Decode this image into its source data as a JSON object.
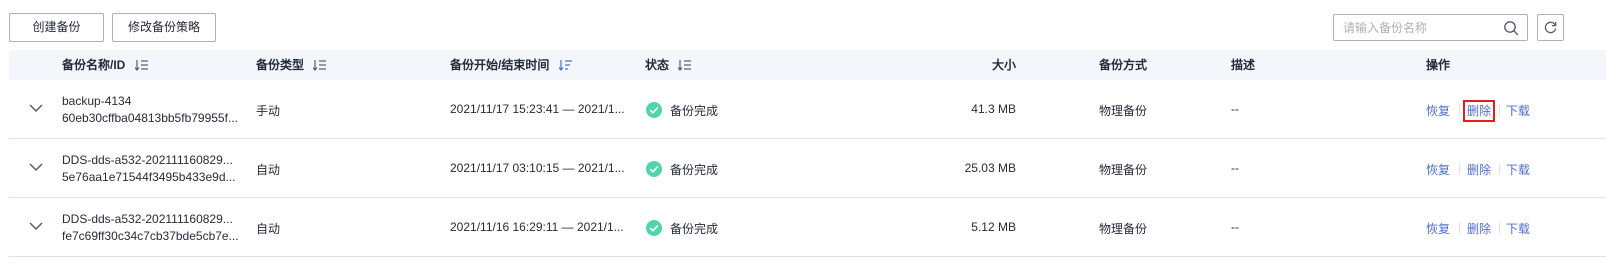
{
  "toolbar": {
    "create_label": "创建备份",
    "policy_label": "修改备份策略",
    "search_placeholder": "请输入备份名称"
  },
  "columns": {
    "name": "备份名称/ID",
    "type": "备份类型",
    "time": "备份开始/结束时间",
    "status": "状态",
    "size": "大小",
    "method": "备份方式",
    "desc": "描述",
    "ops": "操作"
  },
  "rows": [
    {
      "name": "backup-4134",
      "id": "60eb30cffba04813bb5fb79955f...",
      "type": "手动",
      "time": "2021/11/17 15:23:41 — 2021/1...",
      "status": "备份完成",
      "size": "41.3 MB",
      "method": "物理备份",
      "desc": "--",
      "restore": "恢复",
      "delete": "删除",
      "download": "下载"
    },
    {
      "name": "DDS-dds-a532-202111160829...",
      "id": "5e76aa1e71544f3495b433e9d...",
      "type": "自动",
      "time": "2021/11/17 03:10:15 — 2021/1...",
      "status": "备份完成",
      "size": "25.03 MB",
      "method": "物理备份",
      "desc": "--",
      "restore": "恢复",
      "delete": "删除",
      "download": "下载"
    },
    {
      "name": "DDS-dds-a532-202111160829...",
      "id": "fe7c69ff30c34c7cb37bde5cb7e...",
      "type": "自动",
      "time": "2021/11/16 16:29:11 — 2021/1...",
      "status": "备份完成",
      "size": "5.12 MB",
      "method": "物理备份",
      "desc": "--",
      "restore": "恢复",
      "delete": "删除",
      "download": "下载"
    }
  ],
  "colors": {
    "status_ok": "#50d4ab",
    "link": "#526ecc",
    "highlight": "#e02020"
  }
}
